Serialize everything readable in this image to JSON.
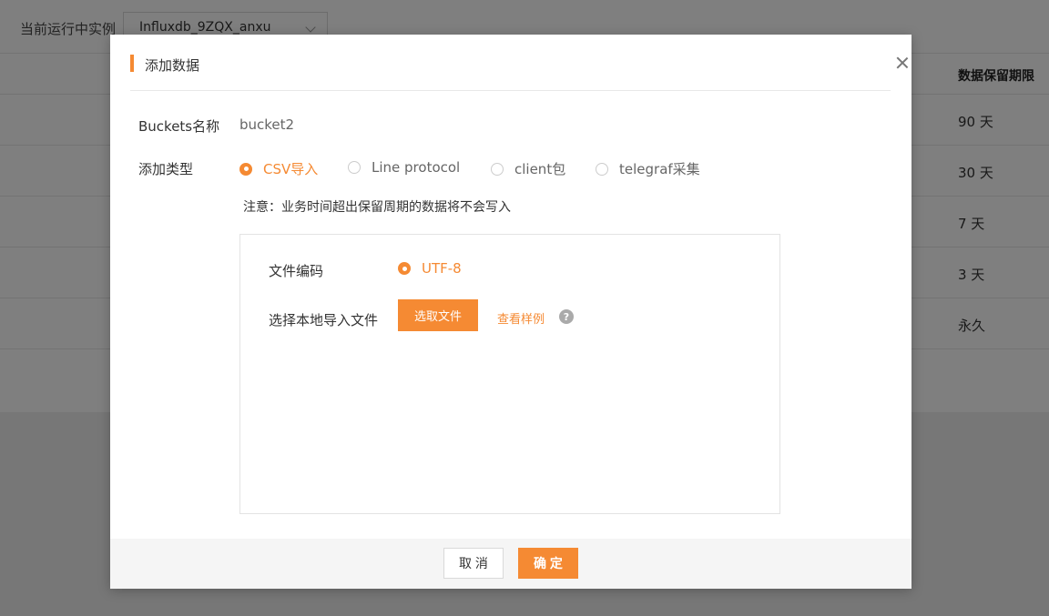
{
  "background": {
    "instance_label": "当前运行中实例",
    "instance_select_value": "Influxdb_9ZQX_anxu",
    "table_header": "数据保留期限",
    "retention_values": [
      "90 天",
      "30 天",
      "7 天",
      "3 天",
      "永久"
    ]
  },
  "modal": {
    "title": "添加数据",
    "bucket_label": "Buckets名称",
    "bucket_value": "bucket2",
    "type_label": "添加类型",
    "type_options": [
      {
        "label": "CSV导入",
        "checked": true
      },
      {
        "label": "Line protocol",
        "checked": false
      },
      {
        "label": "client包",
        "checked": false
      },
      {
        "label": "telegraf采集",
        "checked": false
      }
    ],
    "note": "注意：业务时间超出保留周期的数据将不会写入",
    "encoding_label": "文件编码",
    "encoding_value": "UTF-8",
    "local_file_label": "选择本地导入文件",
    "pick_file_button": "选取文件",
    "view_sample_link": "查看样例",
    "help_icon": "?",
    "cancel_button": "取 消",
    "confirm_button": "确 定"
  },
  "colors": {
    "accent": "#f58a33",
    "overlay": "rgba(0,0,0,0.5)"
  },
  "icons": [
    "close-icon",
    "help-icon",
    "chevron-down-icon"
  ]
}
